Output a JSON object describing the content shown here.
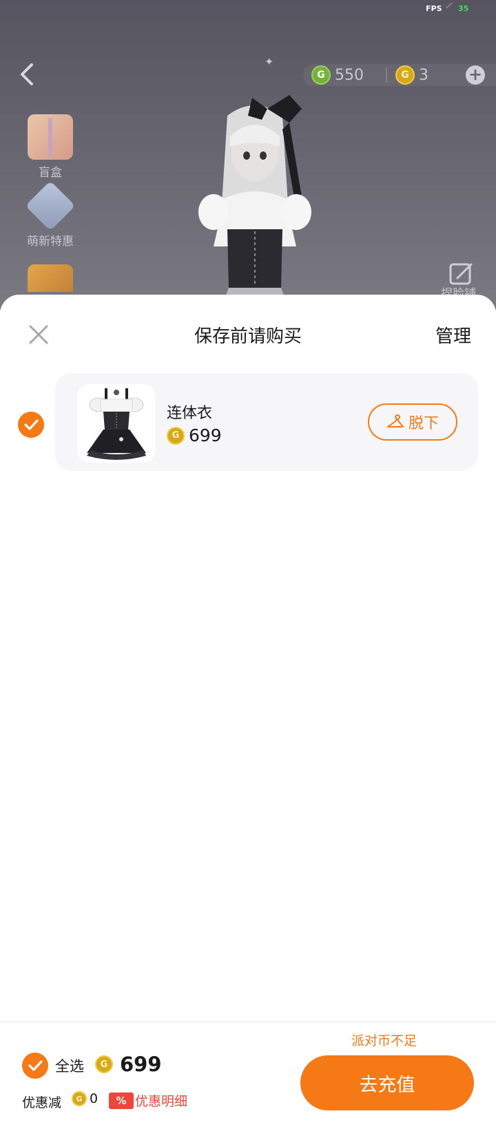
{
  "status": {
    "fps_label": "FPS",
    "fps_value": "35"
  },
  "scene": {
    "currency_green": {
      "icon": "g-coin-green",
      "value": "550"
    },
    "currency_gold": {
      "icon": "g-coin-gold",
      "value": "3"
    },
    "coin_glyph": "G",
    "side_items": [
      {
        "label": "盲盒",
        "icon": "gift-box-icon"
      },
      {
        "label": "萌新特惠",
        "icon": "newbie-deal-icon"
      },
      {
        "label": "",
        "icon": "event-icon"
      }
    ],
    "edit_label": "捏脸铺"
  },
  "sheet": {
    "title": "保存前请购买",
    "manage": "管理",
    "items": [
      {
        "name": "连体衣",
        "price": "699",
        "action": "脱下",
        "selected": true
      }
    ]
  },
  "footer": {
    "insufficient": "派对币不足",
    "select_all": "全选",
    "total": "699",
    "discount_label": "优惠减",
    "discount_value": "0",
    "percent_glyph": "%",
    "detail_link": "优惠明细",
    "recharge": "去充值"
  },
  "colors": {
    "accent": "#f57a16",
    "coupon_red": "#f0453a",
    "gold_coin": "#d6a81a",
    "green_coin": "#76b23a"
  }
}
